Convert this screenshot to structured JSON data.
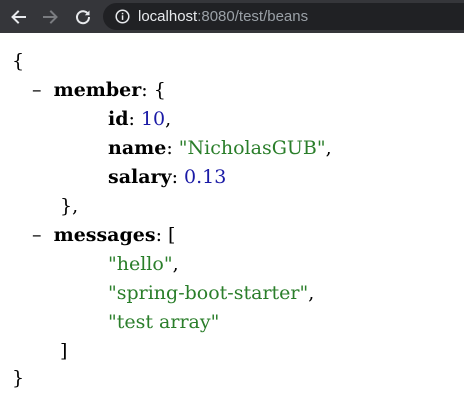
{
  "browser": {
    "url_host": "localhost",
    "url_rest": ":8080/test/beans"
  },
  "json": {
    "open_brace": "{",
    "close_brace": "}",
    "toggle": "–",
    "member": {
      "key": "member",
      "colon": ":",
      "open": "{",
      "close": "},",
      "fields": [
        {
          "key": "id",
          "value": "10",
          "trail": ","
        },
        {
          "key": "name",
          "value": "\"NicholasGUB\"",
          "trail": ","
        },
        {
          "key": "salary",
          "value": "0.13",
          "trail": ""
        }
      ]
    },
    "messages": {
      "key": "messages",
      "colon": ":",
      "open": "[",
      "close": "]",
      "items": [
        {
          "value": "\"hello\"",
          "trail": ","
        },
        {
          "value": "\"spring-boot-starter\"",
          "trail": ","
        },
        {
          "value": "\"test array\"",
          "trail": ""
        }
      ]
    }
  }
}
